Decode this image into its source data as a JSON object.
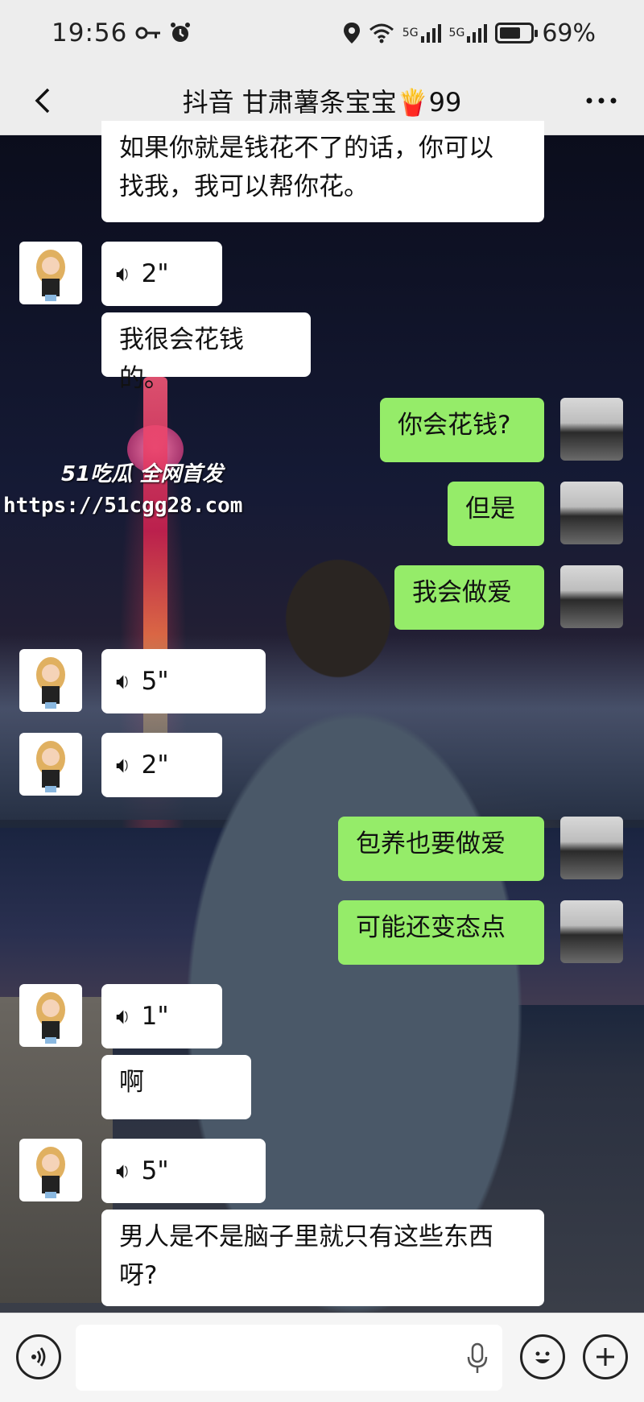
{
  "status": {
    "time": "19:56",
    "signal1": "5G",
    "signal2": "5G",
    "battery": "69%",
    "battery_level": 0.69
  },
  "header": {
    "title": "抖音 甘肃薯条宝宝🍟99"
  },
  "watermark": {
    "title": "51吃瓜 全网首发",
    "url": "https://51cgg28.com"
  },
  "messages": [
    {
      "type": "text",
      "side": "left",
      "text1": "如果你就是钱花不了的话，你可以",
      "text2": "找我，我可以帮你花。"
    },
    {
      "type": "voice",
      "side": "left",
      "duration": "2\""
    },
    {
      "type": "text",
      "side": "left",
      "text": "我很会花钱的。"
    },
    {
      "type": "text",
      "side": "right",
      "text": "你会花钱?"
    },
    {
      "type": "text",
      "side": "right",
      "text": "但是"
    },
    {
      "type": "text",
      "side": "right",
      "text": "我会做爱"
    },
    {
      "type": "voice",
      "side": "left",
      "duration": "5\""
    },
    {
      "type": "voice",
      "side": "left",
      "duration": "2\""
    },
    {
      "type": "text",
      "side": "right",
      "text": "包养也要做爱"
    },
    {
      "type": "text",
      "side": "right",
      "text": "可能还变态点"
    },
    {
      "type": "voice",
      "side": "left",
      "duration": "1\""
    },
    {
      "type": "text",
      "side": "left",
      "text": "啊"
    },
    {
      "type": "voice",
      "side": "left",
      "duration": "5\""
    },
    {
      "type": "text",
      "side": "left",
      "text1": "男人是不是脑子里就只有这些东西",
      "text2": "呀?"
    }
  ],
  "icons": {
    "voice": "voice-wave-icon",
    "emoji": "emoji-icon",
    "plus": "plus-icon",
    "mic": "mic-icon"
  }
}
